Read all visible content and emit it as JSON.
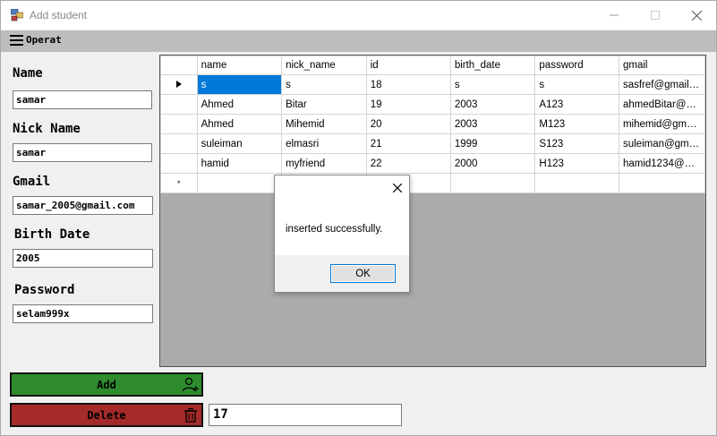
{
  "window": {
    "title": "Add student"
  },
  "menu": {
    "operat_label": "Operat"
  },
  "form": {
    "name_label": "Name",
    "name_value": "samar",
    "nick_label": "Nick Name",
    "nick_value": "samar",
    "gmail_label": "Gmail",
    "gmail_value": "samar_2005@gmail.com",
    "birth_label": "Birth Date",
    "birth_value": "2005",
    "password_label": "Password",
    "password_value": "selam999x"
  },
  "grid": {
    "columns": [
      "name",
      "nick_name",
      "id",
      "birth_date",
      "password",
      "gmail"
    ],
    "rows": [
      [
        "s",
        "s",
        "18",
        "s",
        "s",
        "sasfref@gmail.c..."
      ],
      [
        "Ahmed",
        "Bitar",
        "19",
        "2003",
        "A123",
        "ahmedBitar@gm..."
      ],
      [
        "Ahmed",
        "Mihemid",
        "20",
        "2003",
        "M123",
        "mihemid@gmail...."
      ],
      [
        "suleiman",
        "elmasri",
        "21",
        "1999",
        "S123",
        "suleiman@gmail...."
      ],
      [
        "hamid",
        "myfriend",
        "22",
        "2000",
        "H123",
        "hamid1234@gm..."
      ]
    ],
    "new_row_marker": "*"
  },
  "dialog": {
    "message": "inserted successfully.",
    "ok_label": "OK"
  },
  "actions": {
    "add_label": "Add",
    "delete_label": "Delete",
    "id_value": "17"
  },
  "colors": {
    "add": "#2e8b2e",
    "delete": "#a52a2a",
    "selection": "#0078d7"
  }
}
